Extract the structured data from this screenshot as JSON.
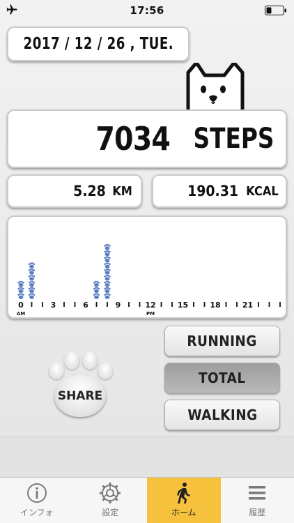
{
  "status_bar": {
    "time": "17:56",
    "airplane_icon": "airplane-icon",
    "battery_icon": "battery-icon"
  },
  "date": "2017 / 12 / 26 , TUE.",
  "steps": {
    "value": "7034",
    "unit": "STEPS"
  },
  "distance": {
    "value": "5.28",
    "unit": "KM"
  },
  "calories": {
    "value": "190.31",
    "unit": "KCAL"
  },
  "chart": {
    "tick_labels": [
      "0",
      "3",
      "6",
      "9",
      "12",
      "15",
      "18",
      "21"
    ],
    "am_label": "AM",
    "pm_label": "PM",
    "paw_color": "#5b7fc2"
  },
  "chart_data": {
    "type": "bar",
    "categories": [
      "0",
      "1",
      "2",
      "3",
      "4",
      "5",
      "6",
      "7",
      "8",
      "9",
      "10",
      "11",
      "12",
      "13",
      "14",
      "15",
      "16",
      "17",
      "18",
      "19",
      "20",
      "21",
      "22",
      "23"
    ],
    "values": [
      3,
      6,
      0,
      0,
      0,
      0,
      0,
      3,
      9,
      0,
      0,
      0,
      0,
      0,
      0,
      0,
      0,
      0,
      0,
      0,
      0,
      0,
      0,
      0
    ],
    "title": "",
    "xlabel": "",
    "ylabel": ""
  },
  "share_label": "SHARE",
  "modes": [
    "RUNNING",
    "TOTAL",
    "WALKING"
  ],
  "active_mode": "TOTAL",
  "tabs": [
    {
      "label": "インフォ",
      "icon": "info-icon"
    },
    {
      "label": "設定",
      "icon": "gear-icon"
    },
    {
      "label": "ホーム",
      "icon": "walking-icon"
    },
    {
      "label": "履歴",
      "icon": "menu-icon"
    }
  ],
  "active_tab": "ホーム",
  "colors": {
    "active_tab": "#f6c13d",
    "paw": "#5b7fc2"
  }
}
